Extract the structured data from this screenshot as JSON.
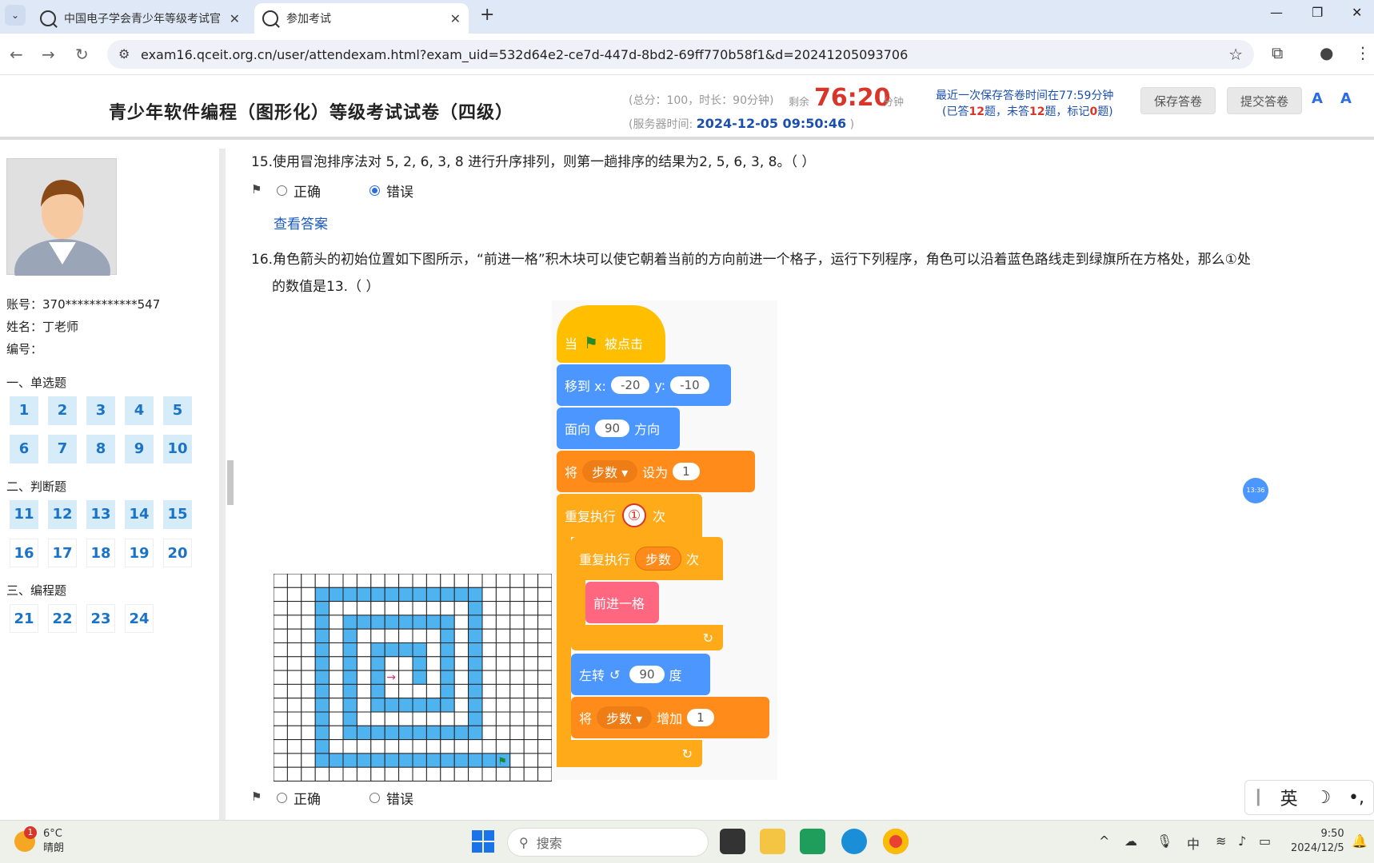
{
  "browser": {
    "tabs": [
      {
        "label": "中国电子学会青少年等级考试官"
      },
      {
        "label": "参加考试"
      }
    ],
    "url": "exam16.qceit.org.cn/user/attendexam.html?exam_uid=532d64e2-ce7d-447d-8bd2-69ff770b58f1&d=20241205093706"
  },
  "header": {
    "title": "青少年软件编程（图形化）等级考试试卷（四级）",
    "meta": "(总分：100，时长：90分钟)",
    "remain_label": "剩余",
    "remain_value": "76:20",
    "remain_unit": "分钟",
    "server_label": "(服务器时间:",
    "server_time": "2024-12-05 09:50:46",
    "server_close": ")",
    "save_info": "最近一次保存答卷时间在77:59分钟",
    "answered_pre": "(已答",
    "answered": "12",
    "answered_mid": "题，未答",
    "unanswered": "12",
    "marked_mid": "题，标记",
    "marked": "0",
    "marked_post": "题)",
    "save_btn": "保存答卷",
    "submit_btn": "提交答卷"
  },
  "sidebar": {
    "account": "账号：370************547",
    "name": "姓名：丁老师",
    "number": "编号：",
    "sections": [
      "一、单选题",
      "二、判断题",
      "三、编程题"
    ],
    "single": [
      "1",
      "2",
      "3",
      "4",
      "5",
      "6",
      "7",
      "8",
      "9",
      "10"
    ],
    "judge": [
      "11",
      "12",
      "13",
      "14",
      "15",
      "16",
      "17",
      "18",
      "19",
      "20"
    ],
    "program": [
      "21",
      "22",
      "23",
      "24"
    ]
  },
  "questions": {
    "q15": "15.使用冒泡排序法对 5, 2, 6, 3, 8 进行升序排列，则第一趟排序的结果为2, 5, 6, 3, 8。（ ）",
    "q16_line1": "16.角色箭头的初始位置如下图所示，“前进一格”积木块可以使它朝着当前的方向前进一个格子，运行下列程序，角色可以沿着蓝色路线走到绿旗所在方格处，那么①处",
    "q16_line2": "的数值是13.（ ）",
    "opt_true": "正确",
    "opt_false": "错误",
    "view_answer": "查看答案"
  },
  "script": {
    "when": "当",
    "clicked": "被点击",
    "goto": "移到 x:",
    "x": "-20",
    "y_label": "y:",
    "y": "-10",
    "face": "面向",
    "face_val": "90",
    "dir": "方向",
    "set": "将",
    "var": "步数",
    "set_to": "设为",
    "set_val": "1",
    "repeat": "重复执行",
    "circle": "①",
    "times": "次",
    "forward": "前进一格",
    "turn": "左转",
    "turn_val": "90",
    "deg": "度",
    "change": "增加",
    "change_val": "1"
  },
  "misc": {
    "timer_bubble": "13:36",
    "ime": [
      "英",
      "☽"
    ]
  },
  "taskbar": {
    "temp": "6°C",
    "weather": "晴朗",
    "badge": "1",
    "search": "搜索",
    "ime_lang": "中",
    "time": "9:50",
    "date": "2024/12/5"
  }
}
